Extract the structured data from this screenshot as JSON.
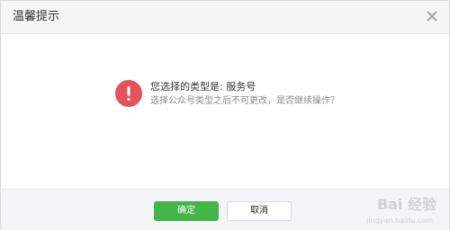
{
  "dialog": {
    "title": "温馨提示",
    "close_icon": "close-icon"
  },
  "message": {
    "icon": "exclamation-icon",
    "icon_color": "#e5535a",
    "title": "您选择的类型是: 服务号",
    "subtitle": "选择公众号类型之后不可更改，是否继续操作？"
  },
  "footer": {
    "confirm_label": "确定",
    "cancel_label": "取消",
    "confirm_color": "#44b549"
  },
  "watermark": {
    "brand": "Bai 经验",
    "url": "jingyan.baidu.com"
  }
}
